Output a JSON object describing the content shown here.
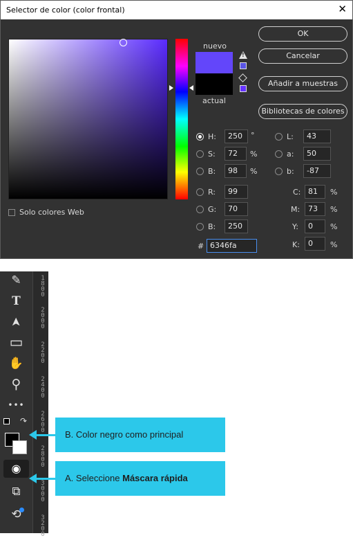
{
  "dialog": {
    "title": "Selector de color (color frontal)",
    "close": "✕",
    "new_label": "nuevo",
    "current_label": "actual",
    "web_only": "Solo colores Web",
    "buttons": {
      "ok": "OK",
      "cancel": "Cancelar",
      "add": "Añadir a muestras",
      "libraries": "Bibliotecas de colores"
    },
    "hsb": [
      {
        "label": "H:",
        "value": "250",
        "unit": "°"
      },
      {
        "label": "S:",
        "value": "72",
        "unit": "%"
      },
      {
        "label": "B:",
        "value": "98",
        "unit": "%"
      }
    ],
    "lab": [
      {
        "label": "L:",
        "value": "43"
      },
      {
        "label": "a:",
        "value": "50"
      },
      {
        "label": "b:",
        "value": "-87"
      }
    ],
    "rgb": [
      {
        "label": "R:",
        "value": "99"
      },
      {
        "label": "G:",
        "value": "70"
      },
      {
        "label": "B:",
        "value": "250"
      }
    ],
    "cmyk": [
      {
        "label": "C:",
        "value": "81",
        "unit": "%"
      },
      {
        "label": "M:",
        "value": "73",
        "unit": "%"
      },
      {
        "label": "Y:",
        "value": "0",
        "unit": "%"
      },
      {
        "label": "K:",
        "value": "0",
        "unit": "%"
      }
    ],
    "hex_label": "#",
    "hex": "6346fa",
    "colors": {
      "new": "#6346fa",
      "current": "#000000"
    }
  },
  "toolbar": {
    "tools": [
      {
        "name": "pen-tool",
        "glyph": "✎"
      },
      {
        "name": "type-tool",
        "glyph": "T"
      },
      {
        "name": "path-selection-tool",
        "glyph": "➤"
      },
      {
        "name": "rectangle-tool",
        "glyph": "▭"
      },
      {
        "name": "hand-tool",
        "glyph": "✋"
      },
      {
        "name": "zoom-tool",
        "glyph": "⚲"
      },
      {
        "name": "more-tools",
        "glyph": "•••"
      }
    ],
    "quick_mask_glyph": "◉",
    "screen_mode_glyph": "⧉",
    "frame_glyph": "⟲"
  },
  "ruler": [
    "1 8 0 0",
    "2 0 0 0",
    "2 2 0 0",
    "2 4 0 0",
    "2 6 0 0",
    "2 8 0 0",
    "3 0 0 0",
    "3 2 0 0"
  ],
  "callouts": {
    "b": "B. Color negro como principal",
    "a_prefix": "A. Seleccione ",
    "a_bold": "Máscara rápida"
  }
}
